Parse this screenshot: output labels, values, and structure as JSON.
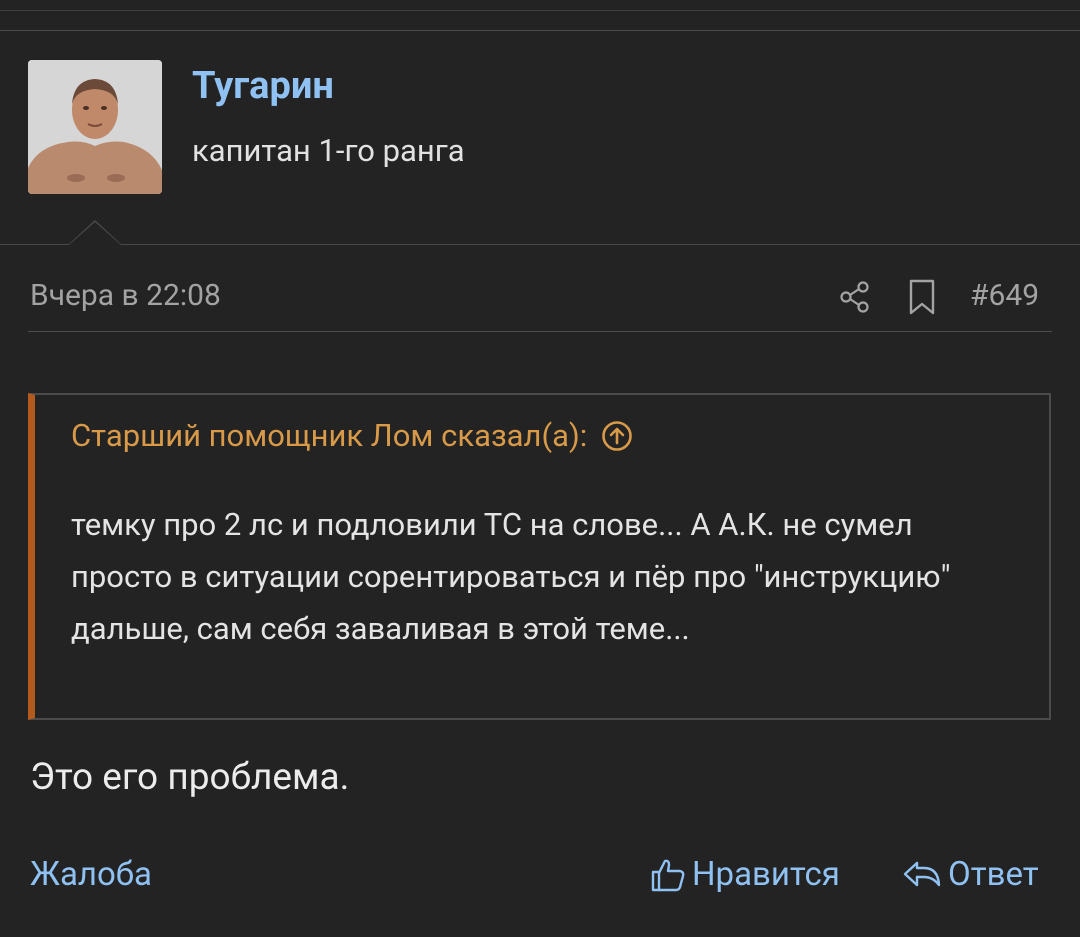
{
  "post": {
    "author": {
      "name": "Тугарин",
      "title": "капитан 1-го ранга"
    },
    "date": "Вчера в 22:08",
    "number": "#649",
    "quote": {
      "header": "Старший помощник Лом сказал(а):",
      "text": "темку про 2 лс и подловили ТС на слове... А А.К. не сумел просто в ситуации сорентироваться и пёр про \"инструкцию\" дальше, сам себя заваливая в этой теме..."
    },
    "message": "Это его проблема.",
    "actions": {
      "report": "Жалоба",
      "like": "Нравится",
      "reply": "Ответ"
    }
  },
  "icons": {
    "share": "share-icon",
    "bookmark": "bookmark-icon",
    "quote_jump": "arrow-up-circle-icon",
    "like": "thumbs-up-icon",
    "reply": "reply-icon"
  },
  "colors": {
    "background": "#232323",
    "link": "#8fc1f2",
    "quote_accent": "#b35a1f",
    "quote_header": "#d89a48",
    "meta_text": "#a3a3a3"
  }
}
